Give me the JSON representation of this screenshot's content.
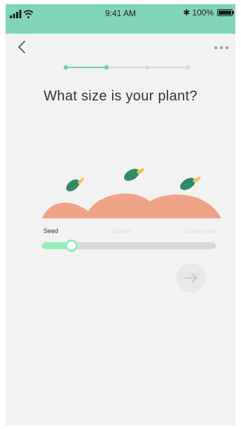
{
  "status_bar": {
    "time": "9:41 AM",
    "battery_percent": "100%",
    "bluetooth_glyph": "✱",
    "background_color": "#82d6b8"
  },
  "navigation": {
    "back_icon": "chevron-left-icon",
    "more_icon": "ellipsis-icon"
  },
  "progress": {
    "total_steps": 4,
    "current_step": 2,
    "active_color": "#6dd1ad",
    "inactive_color": "#d8d8d8"
  },
  "question": {
    "title": "What size is your plant?"
  },
  "size_options": {
    "labels": [
      "Seed",
      "Sprout",
      "Grown plant"
    ],
    "selected": "Seed"
  },
  "slider": {
    "value": 0.17,
    "fill_color": "#94edbc",
    "track_color": "#d9d9d9"
  },
  "next_button": {
    "icon": "arrow-right-icon",
    "enabled": false
  },
  "colors": {
    "mound": "#f0a487",
    "leaf": "#2f8a68",
    "leaf_tip": "#f0c24c",
    "background": "#f2f2f2"
  }
}
